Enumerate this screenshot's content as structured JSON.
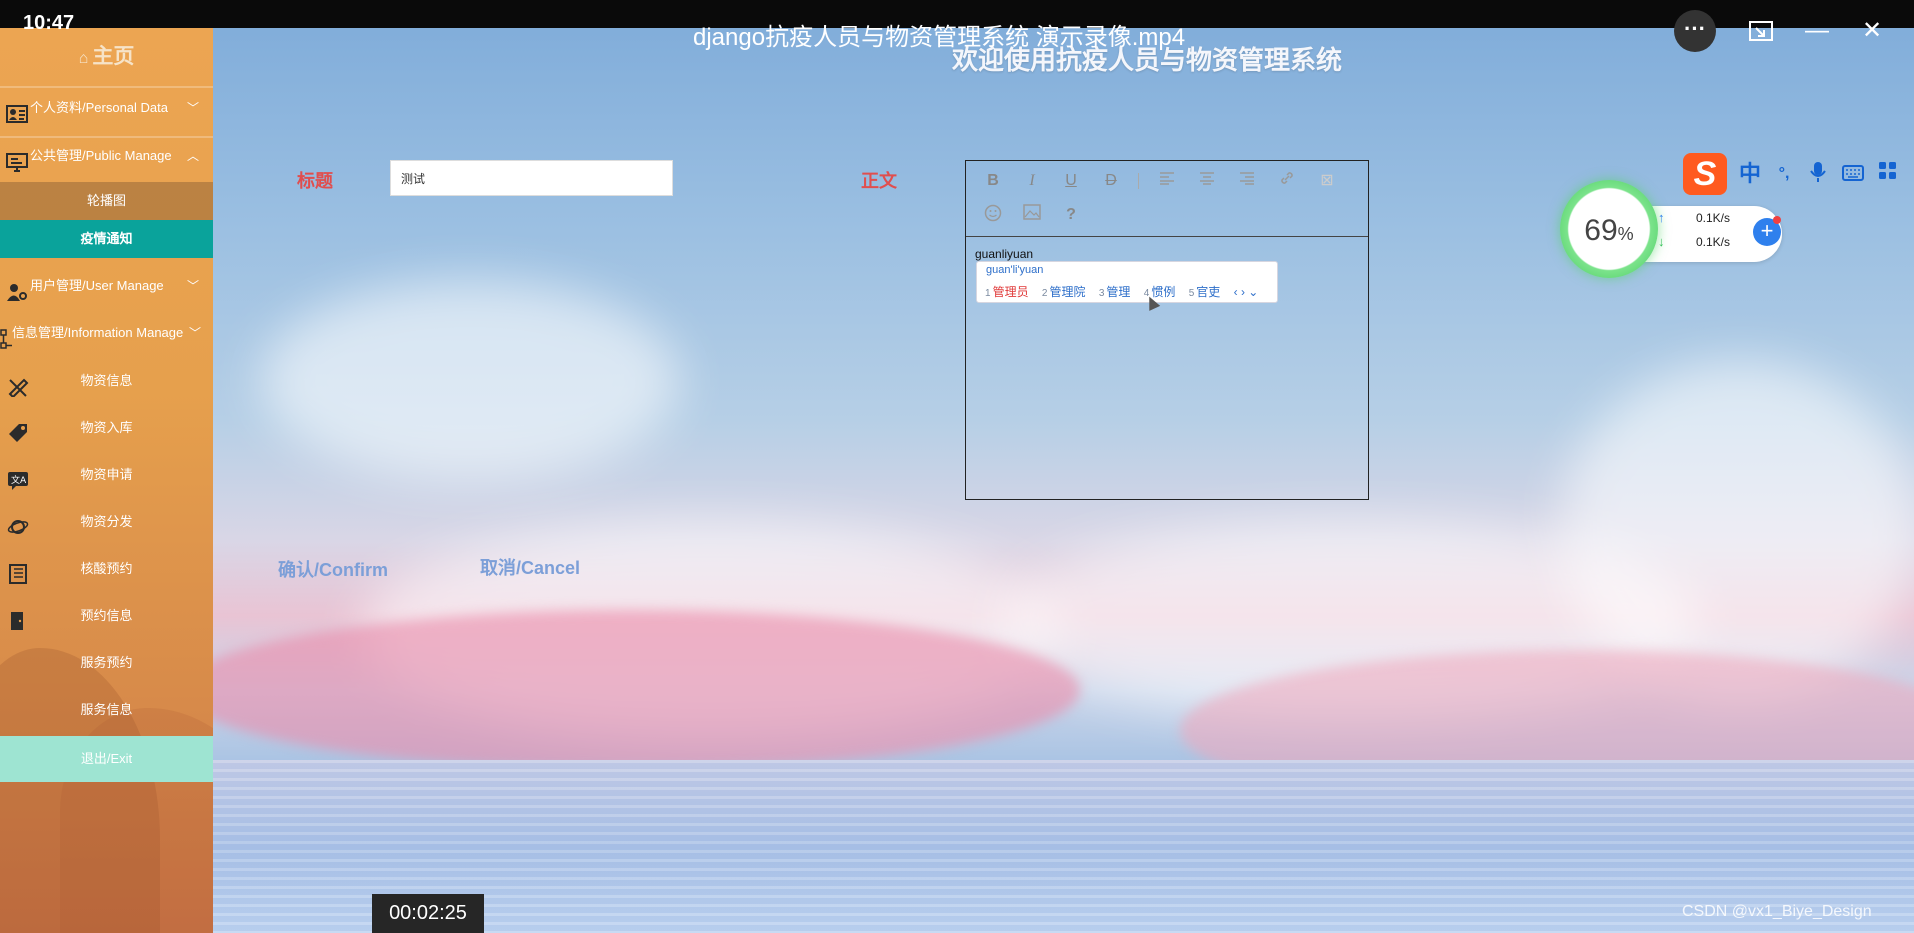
{
  "player": {
    "clock": "10:47",
    "video_title": "django抗疫人员与物资管理系统 演示录像.mp4",
    "more_icon": "more-icon",
    "timestamp": "00:02:25"
  },
  "sidebar": {
    "home_label": "主页",
    "menus": [
      {
        "label": "个人资料/Personal Data",
        "icon": "profile-card-icon",
        "expanded": false
      },
      {
        "label": "公共管理/Public Manage",
        "icon": "monitor-icon",
        "expanded": true
      },
      {
        "label": "用户管理/User Manage",
        "icon": "user-gear-icon",
        "expanded": false
      },
      {
        "label": "信息管理/Information Manage",
        "icon": "hierarchy-icon",
        "expanded": false
      }
    ],
    "public_sub": [
      {
        "label": "轮播图",
        "active": false
      },
      {
        "label": "疫情通知",
        "active": true
      }
    ],
    "items": [
      {
        "label": "物资信息",
        "icon": "pencil-ruler-icon"
      },
      {
        "label": "物资入库",
        "icon": "tag-icon"
      },
      {
        "label": "物资申请",
        "icon": "translate-icon"
      },
      {
        "label": "物资分发",
        "icon": "planet-icon"
      },
      {
        "label": "核酸预约",
        "icon": "book-icon"
      },
      {
        "label": "预约信息",
        "icon": "door-icon"
      },
      {
        "label": "服务预约",
        "icon": ""
      },
      {
        "label": "服务信息",
        "icon": ""
      }
    ],
    "exit_label": "退出/Exit"
  },
  "main": {
    "welcome": "欢迎使用抗疫人员与物资管理系统",
    "title_label": "标题",
    "title_value": "测试",
    "body_label": "正文",
    "editor_text": "guanliyuan",
    "confirm_label": "确认/Confirm",
    "cancel_label": "取消/Cancel",
    "toolbar": [
      "B",
      "I",
      "U",
      "D"
    ]
  },
  "ime": {
    "pinyin": "guan'li'yuan",
    "candidates": [
      {
        "n": "1",
        "text": "管理员"
      },
      {
        "n": "2",
        "text": "管理院"
      },
      {
        "n": "3",
        "text": "管理"
      },
      {
        "n": "4",
        "text": "惯例"
      },
      {
        "n": "5",
        "text": "官吏"
      }
    ],
    "toolbar": [
      "中",
      "°,"
    ]
  },
  "netmon": {
    "percent": "69",
    "upload": "0.1K/s",
    "download": "0.1K/s"
  },
  "watermark": "CSDN @vx1_Biye_Design"
}
